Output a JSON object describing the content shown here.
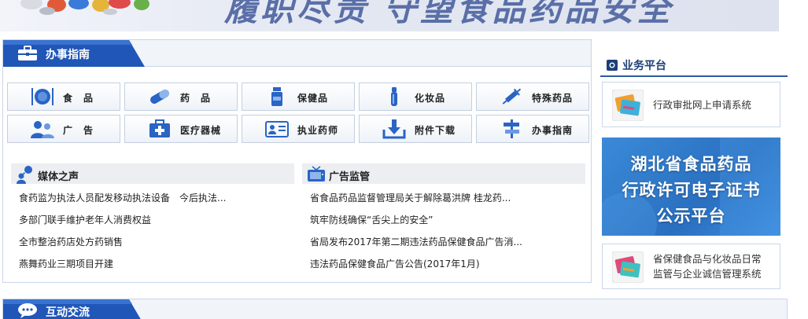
{
  "banner": {
    "text": "履职尽责 守望食品药品安全"
  },
  "colors": {
    "primary_blue": "#1f56b7",
    "border": "#c9d6e8",
    "promo_blue": "#2f78cc"
  },
  "guide": {
    "title": "办事指南",
    "buttons": [
      {
        "label": "食　品",
        "icon": "plate-icon"
      },
      {
        "label": "药　品",
        "icon": "pill-icon"
      },
      {
        "label": "保健品",
        "icon": "bottle-icon"
      },
      {
        "label": "化妆品",
        "icon": "cosmetic-icon"
      },
      {
        "label": "特殊药品",
        "icon": "syringe-icon"
      },
      {
        "label": "广　告",
        "icon": "people-icon"
      },
      {
        "label": "医疗器械",
        "icon": "medkit-icon"
      },
      {
        "label": "执业药师",
        "icon": "idcard-icon"
      },
      {
        "label": "附件下载",
        "icon": "download-icon"
      },
      {
        "label": "办事指南",
        "icon": "signpost-icon"
      }
    ]
  },
  "media": {
    "title": "媒体之声",
    "items": [
      "食药监为执法人员配发移动执法设备　今后执法...",
      "多部门联手维护老年人消费权益",
      "全市整治药店处方药销售",
      "燕舞药业三期项目开建"
    ]
  },
  "ads": {
    "title": "广告监管",
    "items": [
      "省食品药品监督管理局关于解除葛洪牌 桂龙药...",
      "筑牢防线确保“舌尖上的安全”",
      "省局发布2017年第二期违法药品保健食品广告消...",
      "违法药品保健食品广告公告(2017年1月)"
    ]
  },
  "platform": {
    "title": "业务平台",
    "service1": "行政审批网上申请系统",
    "promo_lines": [
      "湖北省食品药品",
      "行政许可电子证书",
      "公示平台"
    ],
    "service2_line1": "省保健食品与化妆品日常",
    "service2_line2": "监管与企业诚信管理系统"
  },
  "interaction": {
    "title": "互动交流"
  }
}
